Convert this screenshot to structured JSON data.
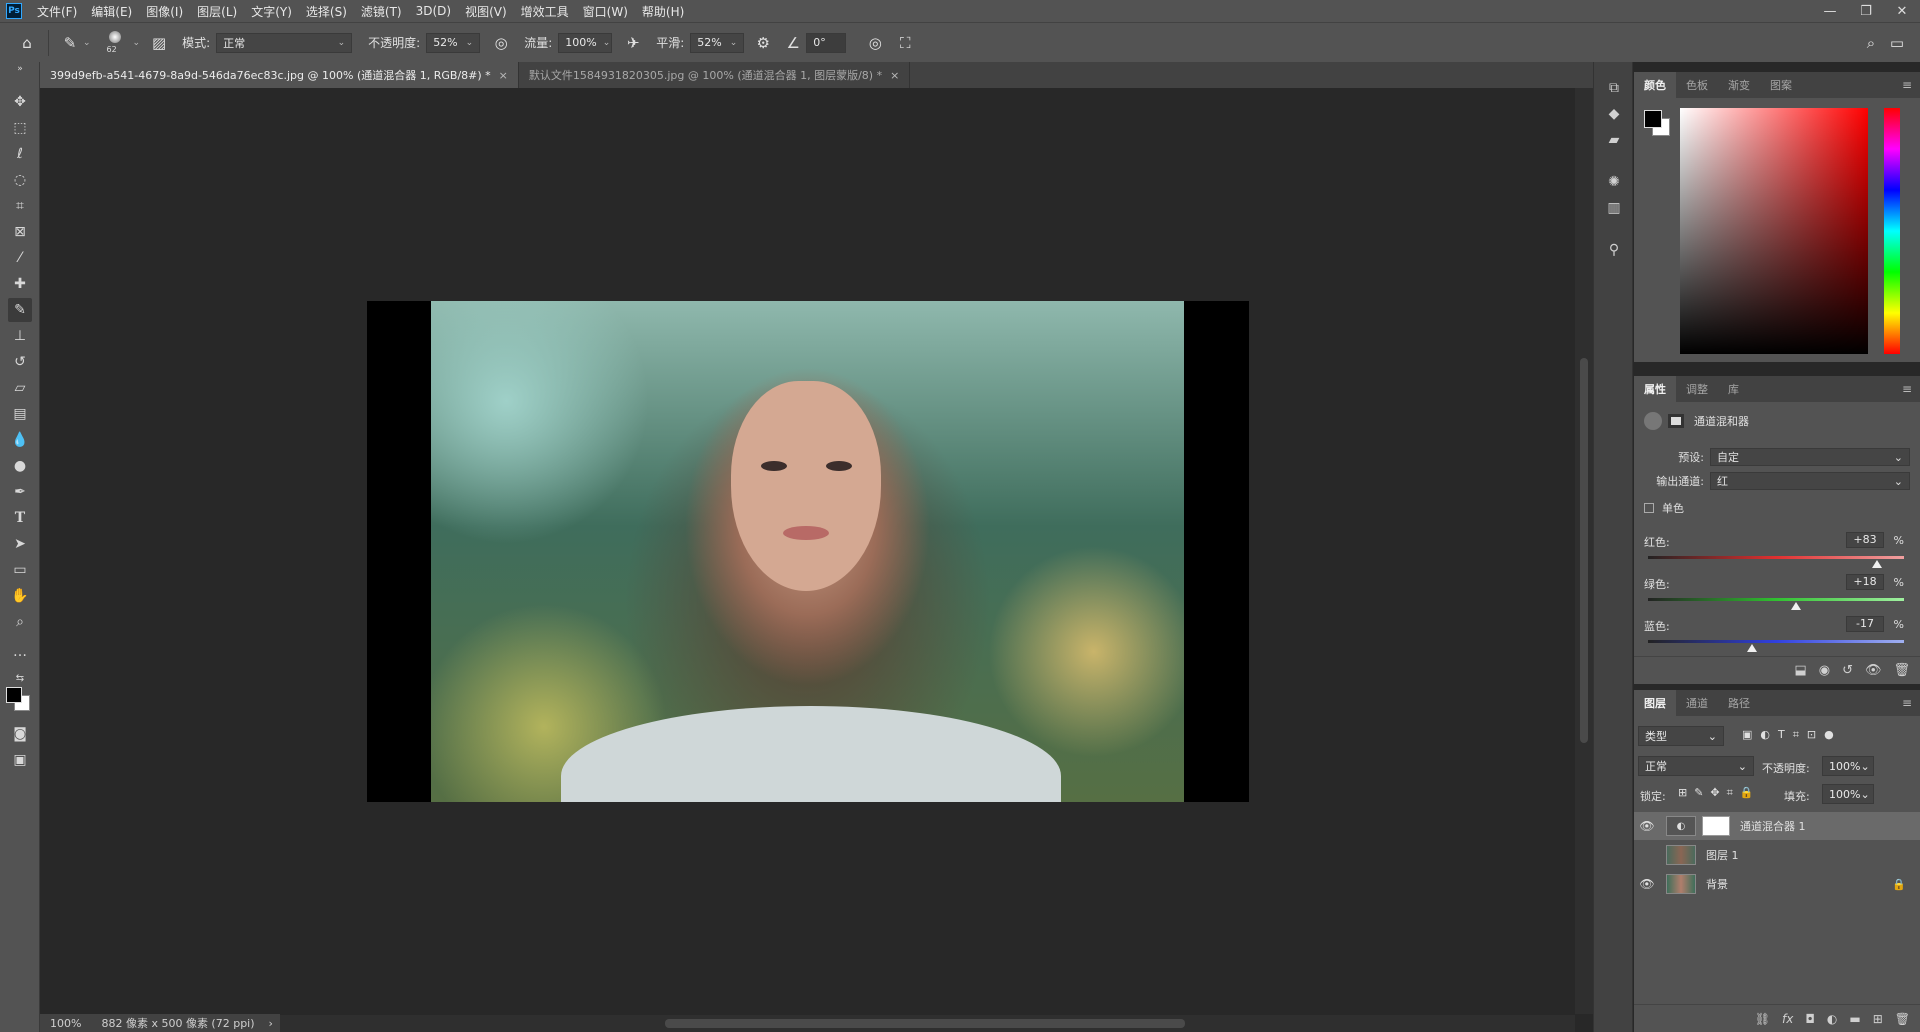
{
  "menubar": {
    "logo": "Ps",
    "items": [
      "文件(F)",
      "编辑(E)",
      "图像(I)",
      "图层(L)",
      "文字(Y)",
      "选择(S)",
      "滤镜(T)",
      "3D(D)",
      "视图(V)",
      "增效工具",
      "窗口(W)",
      "帮助(H)"
    ],
    "window_controls": [
      "—",
      "❐",
      "✕"
    ]
  },
  "optionsbar": {
    "brush_size": "62",
    "mode_label": "模式:",
    "mode_value": "正常",
    "opacity_label": "不透明度:",
    "opacity_value": "52%",
    "flow_label": "流量:",
    "flow_value": "100%",
    "smoothing_label": "平滑:",
    "smoothing_value": "52%",
    "angle_value": "0°"
  },
  "tabs": [
    {
      "label": "399d9efb-a541-4679-8a9d-546da76ec83c.jpg @ 100% (通道混合器 1, RGB/8#) *",
      "close": "×"
    },
    {
      "label": "默认文件1584931820305.jpg @ 100% (通道混合器 1, 图层蒙版/8) *",
      "close": "×"
    }
  ],
  "statusbar": {
    "zoom": "100%",
    "doc_info": "882 像素 x 500 像素 (72 ppi)",
    "arrow": "›"
  },
  "color_panel": {
    "tabs": [
      "颜色",
      "色板",
      "渐变",
      "图案"
    ]
  },
  "properties_panel": {
    "tabs": [
      "属性",
      "调整",
      "库"
    ],
    "title": "通道混和器",
    "preset_label": "预设:",
    "preset_value": "自定",
    "output_label": "输出通道:",
    "output_value": "红",
    "mono_label": "单色",
    "red_label": "红色:",
    "red_value": "+83",
    "green_label": "绿色:",
    "green_value": "+18",
    "blue_label": "蓝色:",
    "blue_value": "-17",
    "percent": "%",
    "red_fraction": 0.915,
    "green_fraction": 0.59,
    "blue_fraction": 0.415
  },
  "layers_panel": {
    "tabs": [
      "图层",
      "通道",
      "路径"
    ],
    "filter_value": "类型",
    "blend_value": "正常",
    "opacity_label": "不透明度:",
    "opacity_value": "100%",
    "lock_label": "锁定:",
    "fill_label": "填充:",
    "fill_value": "100%",
    "layers": [
      {
        "name": "通道混合器 1",
        "visible": true,
        "selected": true
      },
      {
        "name": "图层 1",
        "visible": false,
        "selected": false
      },
      {
        "name": "背景",
        "visible": true,
        "selected": false
      }
    ],
    "footer_icons": [
      "link-icon",
      "fx-icon",
      "mask-icon",
      "adjustment-icon",
      "group-icon",
      "new-layer-icon",
      "trash-icon"
    ]
  },
  "colors": {
    "accent": "#31a8ff",
    "panel_bg": "#535353",
    "canvas_bg": "#282828"
  }
}
